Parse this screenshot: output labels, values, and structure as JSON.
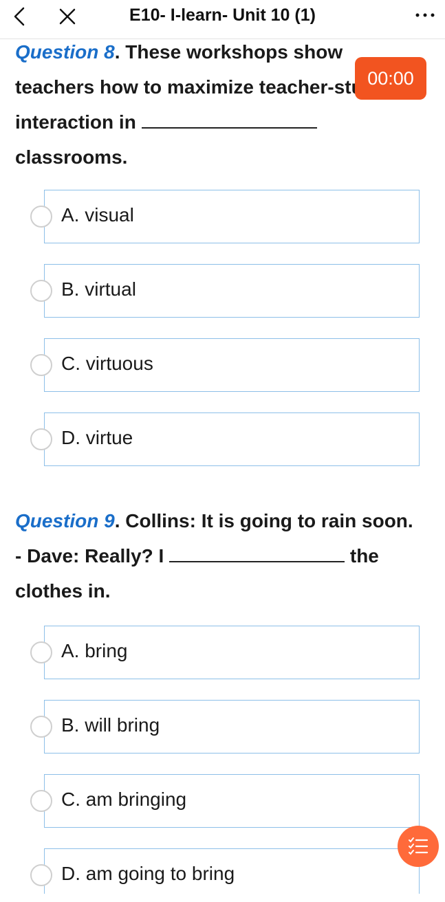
{
  "header": {
    "title": "E10- I-learn- Unit 10 (1)",
    "back_icon": "chevron-left-icon",
    "close_icon": "close-icon",
    "more_icon": "more-dots-icon"
  },
  "timer": {
    "value": "00:00",
    "color": "#f25420"
  },
  "questions": [
    {
      "label": "Question 8",
      "text_before": ". These workshops show teachers how to maximize teacher-student interaction in ",
      "text_after": " classrooms.",
      "options": [
        "A. visual",
        "B. virtual",
        "C. virtuous",
        "D. virtue"
      ]
    },
    {
      "label": "Question 9",
      "text_before": ". Collins: It is going to rain soon. - Dave: Really? I ",
      "text_after": " the clothes in.",
      "options": [
        "A. bring",
        "B. will bring",
        "C. am bringing",
        "D. am going to bring"
      ]
    }
  ],
  "fab": {
    "icon": "list-checks-icon"
  },
  "colors": {
    "accent": "#1a6ec9",
    "border": "#8cbfe8",
    "timer": "#f25420"
  }
}
